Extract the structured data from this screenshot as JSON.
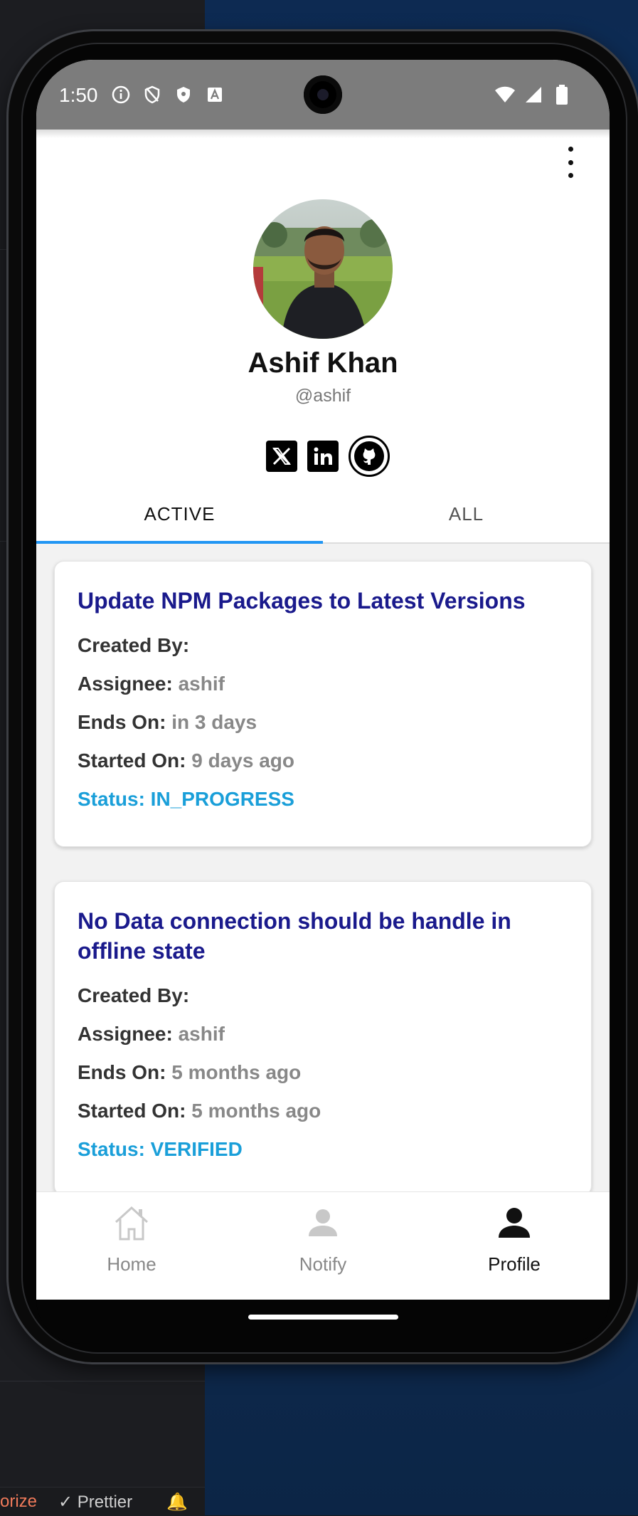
{
  "system": {
    "time": "1:50"
  },
  "profile": {
    "name": "Ashif Khan",
    "handle": "@ashif"
  },
  "socials": {
    "items": [
      "x-icon",
      "linkedin-icon",
      "github-icon"
    ]
  },
  "tabs": {
    "active": "ACTIVE",
    "all": "ALL"
  },
  "tasks": [
    {
      "title": "Update NPM Packages to Latest Versions",
      "created_by_label": "Created By:",
      "created_by": "",
      "assignee_label": "Assignee:",
      "assignee": "ashif",
      "ends_on_label": "Ends On:",
      "ends_on": "in 3 days",
      "started_on_label": "Started On:",
      "started_on": "9 days ago",
      "status": "Status: IN_PROGRESS"
    },
    {
      "title": "No Data connection should be handle in offline state",
      "created_by_label": "Created By:",
      "created_by": "",
      "assignee_label": "Assignee:",
      "assignee": "ashif",
      "ends_on_label": "Ends On:",
      "ends_on": "5 months ago",
      "started_on_label": "Started On:",
      "started_on": "5 months ago",
      "status": "Status: VERIFIED"
    }
  ],
  "nav": {
    "home": "Home",
    "notify": "Notify",
    "profile": "Profile"
  },
  "editor_statusbar": {
    "left": "orize",
    "prettier": "Prettier"
  },
  "colors": {
    "title": "#1a1a8c",
    "status": "#1a9fd9",
    "tab_indicator": "#2196f3"
  }
}
